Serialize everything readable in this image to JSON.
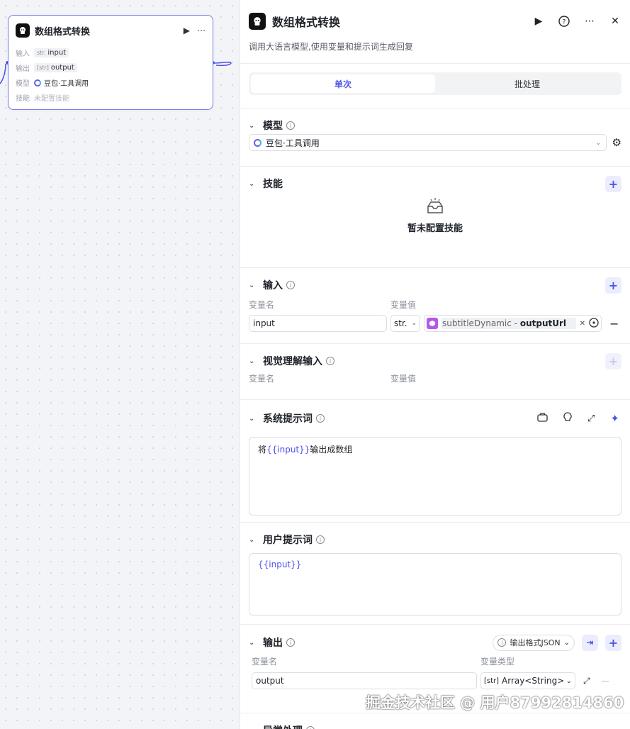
{
  "node": {
    "title": "数组格式转换",
    "rows": [
      {
        "key": "输入",
        "type": "str.",
        "value": "input"
      },
      {
        "key": "输出",
        "type": "[str]",
        "value": "output"
      },
      {
        "key": "模型",
        "value": "豆包·工具调用"
      },
      {
        "key": "技能",
        "value": "未配置技能"
      }
    ]
  },
  "panel": {
    "title": "数组格式转换",
    "description": "调用大语言模型,使用变量和提示词生成回复",
    "tabs": [
      "单次",
      "批处理"
    ],
    "model": {
      "title": "模型",
      "selected": "豆包·工具调用"
    },
    "skills": {
      "title": "技能",
      "empty_text": "暂未配置技能"
    },
    "inputs": {
      "title": "输入",
      "col_name": "变量名",
      "col_value": "变量值",
      "row": {
        "name": "input",
        "type": "str.",
        "ref_node": "subtitleDynamic",
        "ref_sep": " - ",
        "ref_field": "outputUrl"
      }
    },
    "vision": {
      "title": "视觉理解输入",
      "col_name": "变量名",
      "col_value": "变量值"
    },
    "system_prompt": {
      "title": "系统提示词",
      "prefix": "将",
      "var": "{{input}}",
      "suffix": "输出成数组"
    },
    "user_prompt": {
      "title": "用户提示词",
      "var": "{{input}}"
    },
    "outputs": {
      "title": "输出",
      "format_label": "输出格式JSON",
      "col_name": "变量名",
      "col_type": "变量类型",
      "row": {
        "name": "output",
        "type_badge": "[str]",
        "type": "Array<String>"
      }
    },
    "error": {
      "title": "异常处理"
    }
  },
  "watermark": "掘金技术社区 @ 用户8799281486​0"
}
